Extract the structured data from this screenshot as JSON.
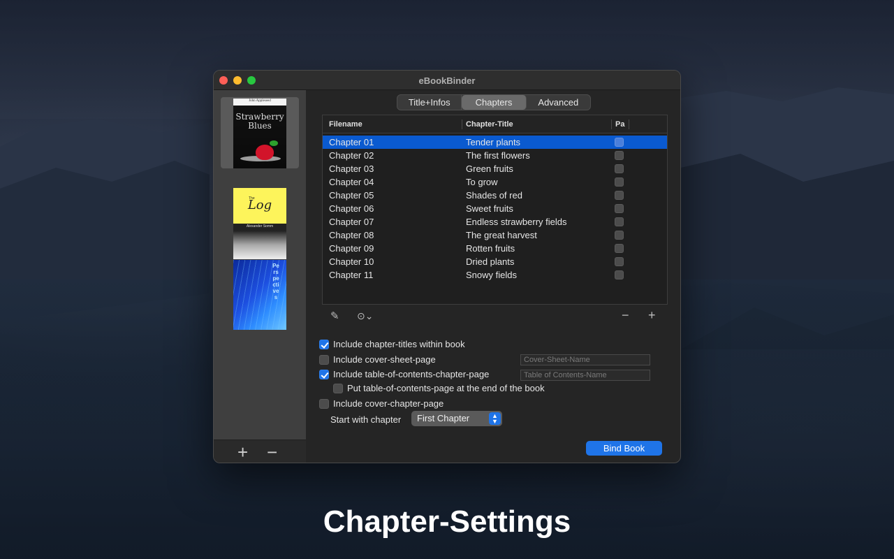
{
  "window": {
    "title": "eBookBinder"
  },
  "sidebar": {
    "covers": [
      {
        "author": "John Appleseed",
        "title": "Strawberry Blues"
      },
      {
        "small": "The",
        "title": "Log",
        "author": "Alexander Somm"
      },
      {
        "title": "Perspectives"
      }
    ],
    "add_label": "+",
    "remove_label": "−"
  },
  "tabs": [
    {
      "label": "Title+Infos",
      "active": false
    },
    {
      "label": "Chapters",
      "active": true
    },
    {
      "label": "Advanced",
      "active": false
    }
  ],
  "table": {
    "columns": [
      "Filename",
      "Chapter-Title",
      "Pa"
    ],
    "rows": [
      {
        "filename": "Chapter 01",
        "title": "Tender plants",
        "checked": false,
        "selected": true
      },
      {
        "filename": "Chapter 02",
        "title": "The first flowers",
        "checked": false,
        "selected": false
      },
      {
        "filename": "Chapter 03",
        "title": "Green fruits",
        "checked": false,
        "selected": false
      },
      {
        "filename": "Chapter 04",
        "title": "To grow",
        "checked": false,
        "selected": false
      },
      {
        "filename": "Chapter 05",
        "title": "Shades of red",
        "checked": false,
        "selected": false
      },
      {
        "filename": "Chapter 06",
        "title": "Sweet fruits",
        "checked": false,
        "selected": false
      },
      {
        "filename": "Chapter 07",
        "title": "Endless strawberry fields",
        "checked": false,
        "selected": false
      },
      {
        "filename": "Chapter 08",
        "title": "The great harvest",
        "checked": false,
        "selected": false
      },
      {
        "filename": "Chapter 09",
        "title": "Rotten fruits",
        "checked": false,
        "selected": false
      },
      {
        "filename": "Chapter 10",
        "title": "Dried plants",
        "checked": false,
        "selected": false
      },
      {
        "filename": "Chapter 11",
        "title": "Snowy fields",
        "checked": false,
        "selected": false
      }
    ]
  },
  "toolbar": {
    "remove_label": "−",
    "add_label": "+"
  },
  "options": {
    "include_chapter_titles": {
      "label": "Include chapter-titles within book",
      "checked": true
    },
    "include_cover_sheet": {
      "label": "Include cover-sheet-page",
      "checked": false,
      "placeholder": "Cover-Sheet-Name"
    },
    "include_toc": {
      "label": "Include table-of-contents-chapter-page",
      "checked": true,
      "placeholder": "Table of Contents-Name"
    },
    "toc_at_end": {
      "label": "Put table-of-contents-page at the end of the book",
      "checked": false
    },
    "include_cover_chapter": {
      "label": "Include cover-chapter-page",
      "checked": false
    }
  },
  "start_with": {
    "label": "Start with chapter",
    "value": "First Chapter"
  },
  "bind_button": "Bind Book",
  "caption": "Chapter-Settings",
  "colors": {
    "accent": "#1f74e8",
    "selection": "#0a5ad0",
    "window_bg": "#252525",
    "sidebar_bg": "#3f3f3f"
  }
}
